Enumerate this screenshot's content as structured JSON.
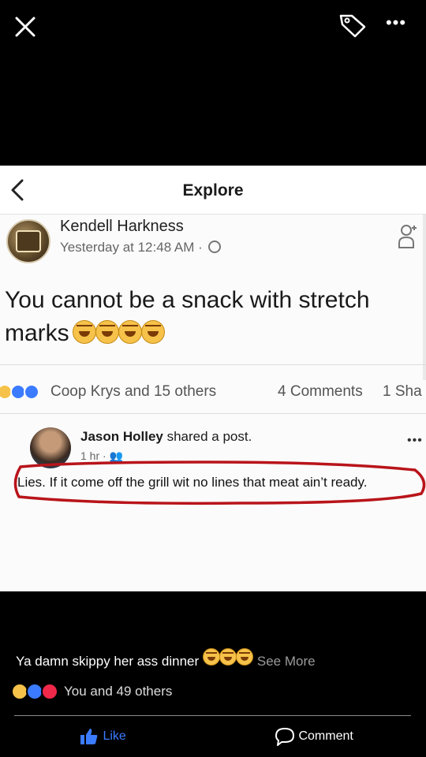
{
  "viewer": {
    "close_icon": "close-icon",
    "tag_icon": "tag-icon",
    "more_label": "•••"
  },
  "photo": {
    "header_title": "Explore",
    "post": {
      "author": "Kendell Harkness",
      "timestamp": "Yesterday at 12:48 AM · ",
      "text": "You cannot be a snack with stretch marks",
      "reactions_label": "Coop Krys and 15 others",
      "comments": "4 Comments",
      "shares": "1 Sha"
    },
    "shared": {
      "name": "Jason Holley",
      "action": " shared a post.",
      "meta": "1 hr · ",
      "more": "•••",
      "comment": "Lies. If it come off the grill wit no lines that meat ain’t ready."
    }
  },
  "caption": {
    "text": "Ya damn skippy her ass dinner",
    "see_more": "See More",
    "likes": "You and 49 others"
  },
  "actions": {
    "like_label": "Like",
    "comment_label": "Comment"
  },
  "colors": {
    "like_blue": "#3b7bff",
    "circle_red": "#b8141a",
    "love_red": "#f0284a",
    "haha_yellow": "#f6c24a"
  }
}
